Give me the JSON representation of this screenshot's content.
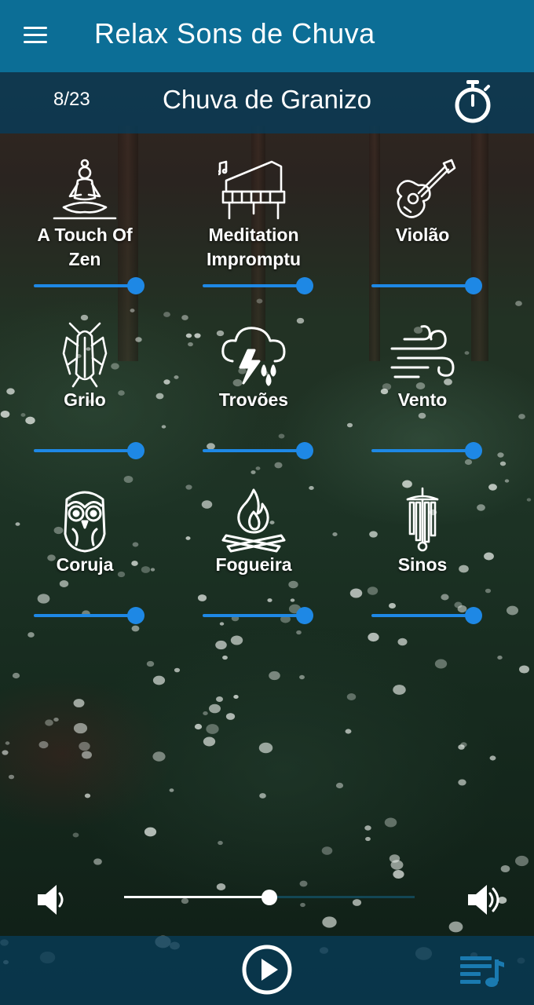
{
  "app": {
    "title": "Relax Sons de Chuva"
  },
  "now_playing": {
    "counter": "8/23",
    "title": "Chuva de Granizo"
  },
  "sounds": [
    {
      "label": "A Touch Of\nZen",
      "icon": "meditation-icon",
      "volume": 1.0
    },
    {
      "label": "Meditation\nImpromptu",
      "icon": "piano-icon",
      "volume": 1.0
    },
    {
      "label": "Violão",
      "icon": "guitar-icon",
      "volume": 1.0
    },
    {
      "label": "Grilo",
      "icon": "cricket-icon",
      "volume": 1.0
    },
    {
      "label": "Trovões",
      "icon": "thunderstorm-icon",
      "volume": 1.0
    },
    {
      "label": "Vento",
      "icon": "wind-icon",
      "volume": 1.0
    },
    {
      "label": "Coruja",
      "icon": "owl-icon",
      "volume": 1.0
    },
    {
      "label": "Fogueira",
      "icon": "campfire-icon",
      "volume": 1.0
    },
    {
      "label": "Sinos",
      "icon": "wind-chimes-icon",
      "volume": 1.0
    }
  ],
  "master_volume": 0.5,
  "colors": {
    "appbar": "#0c6e96",
    "accent": "#1e88e5",
    "playlist_icon": "#1a7ab0"
  }
}
